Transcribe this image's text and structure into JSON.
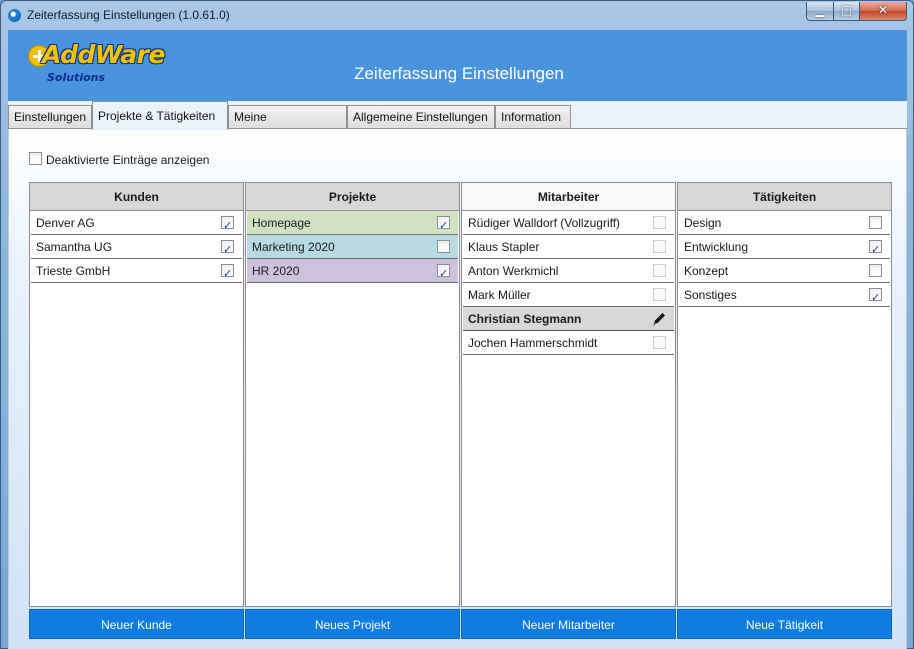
{
  "window": {
    "title": "Zeiterfassung Einstellungen (1.0.61.0)",
    "minimize_icon": "minimize-icon",
    "maximize_icon": "maximize-icon",
    "close_icon": "close-icon",
    "min_glyph": "▁",
    "max_glyph": "□",
    "close_glyph": "✕"
  },
  "header": {
    "logo_word": "AddWare",
    "logo_sub": "Solutions",
    "title": "Zeiterfassung Einstellungen",
    "brand_color": "#4a94dd"
  },
  "tabs": [
    {
      "label": "Einstellungen",
      "active": false
    },
    {
      "label": "Projekte & Tätigkeiten",
      "active": true
    },
    {
      "label": "Meine Einstellungen",
      "active": false
    },
    {
      "label": "Allgemeine Einstellungen",
      "active": false
    },
    {
      "label": "Information",
      "active": false
    }
  ],
  "show_disabled": {
    "label": "Deaktivierte Einträge anzeigen",
    "checked": false
  },
  "columns": {
    "kunden": {
      "header": "Kunden",
      "items": [
        {
          "label": "Denver AG",
          "checked": true
        },
        {
          "label": "Samantha UG",
          "checked": true
        },
        {
          "label": "Trieste GmbH",
          "checked": true
        }
      ],
      "button": "Neuer Kunde"
    },
    "projekte": {
      "header": "Projekte",
      "items": [
        {
          "label": "Homepage",
          "checked": true,
          "color": "#d0e2c0"
        },
        {
          "label": "Marketing 2020",
          "checked": false,
          "color": "#b6dbe4"
        },
        {
          "label": "HR 2020",
          "checked": true,
          "color": "#cfc2df"
        }
      ],
      "button": "Neues Projekt"
    },
    "mitarbeiter": {
      "header": "Mitarbeiter",
      "items": [
        {
          "label": "Rüdiger Walldorf (Vollzugriff)",
          "checked": false
        },
        {
          "label": "Klaus Stapler",
          "checked": false
        },
        {
          "label": "Anton Werkmichl",
          "checked": false
        },
        {
          "label": "Mark Müller",
          "checked": false
        },
        {
          "label": "Christian Stegmann",
          "editing": true,
          "icon": "pencil-icon"
        },
        {
          "label": "Jochen Hammerschmidt",
          "checked": false
        }
      ],
      "button": "Neuer Mitarbeiter"
    },
    "taetigkeiten": {
      "header": "Tätigkeiten",
      "items": [
        {
          "label": "Design",
          "checked": false
        },
        {
          "label": "Entwicklung",
          "checked": true
        },
        {
          "label": "Konzept",
          "checked": false
        },
        {
          "label": "Sonstiges",
          "checked": true
        }
      ],
      "button": "Neue Tätigkeit"
    }
  },
  "accent_color": "#0f7ae0"
}
